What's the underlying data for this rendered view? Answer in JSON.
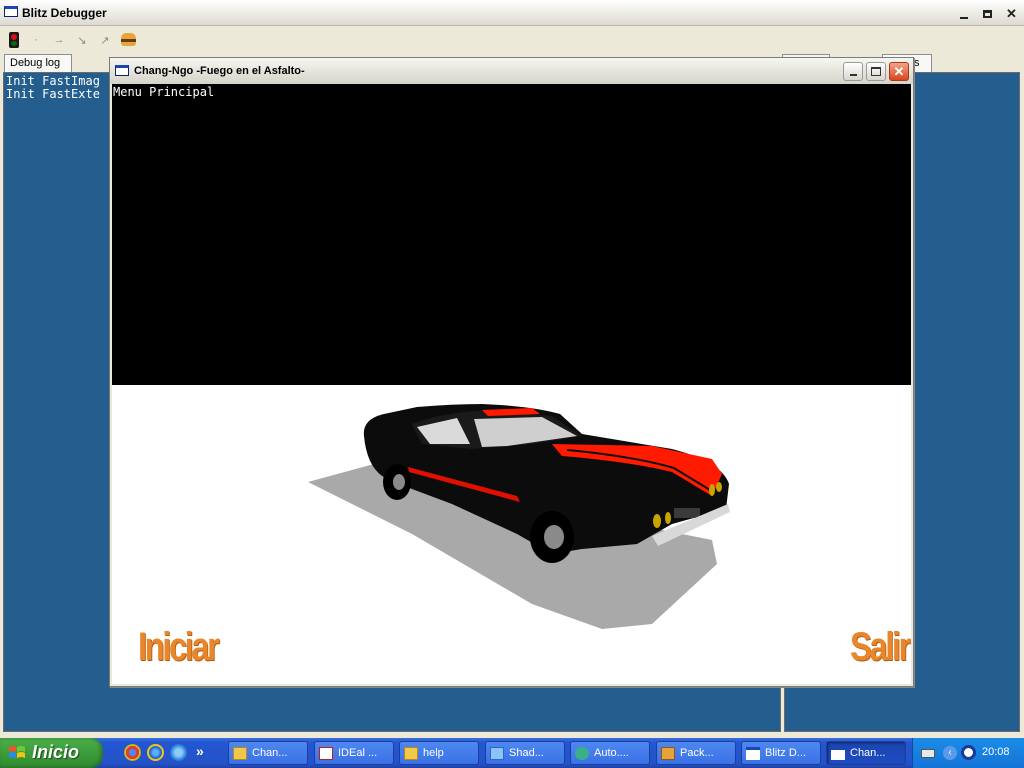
{
  "debugger": {
    "title": "Blitz Debugger",
    "tabs": [
      {
        "label": "Debug log"
      },
      {
        "label": "ts"
      }
    ],
    "log_lines": [
      "Init FastImag",
      "Init FastExte"
    ]
  },
  "game": {
    "title": "Chang-Ngo -Fuego en el Asfalto-",
    "menu_caption": "Menu Principal",
    "option_start": "Iniciar",
    "option_exit": "Salir",
    "colors": {
      "option": "#E8862B",
      "car_stripe": "#FF1A00",
      "floor": "#FFFFFF",
      "sky": "#000000"
    }
  },
  "taskbar": {
    "start_label": "Inicio",
    "quicklaunch_more": "»",
    "tasks": [
      {
        "label": "Chan...",
        "icon": "folder-icon"
      },
      {
        "label": "IDEal ...",
        "icon": "document-icon"
      },
      {
        "label": "help",
        "icon": "folder-icon"
      },
      {
        "label": "Shad...",
        "icon": "document-icon"
      },
      {
        "label": "Auto....",
        "icon": "app-icon"
      },
      {
        "label": "Pack...",
        "icon": "package-icon"
      },
      {
        "label": "Blitz D...",
        "icon": "window-icon"
      },
      {
        "label": "Chan...",
        "icon": "window-icon"
      }
    ],
    "clock": "20:08"
  }
}
